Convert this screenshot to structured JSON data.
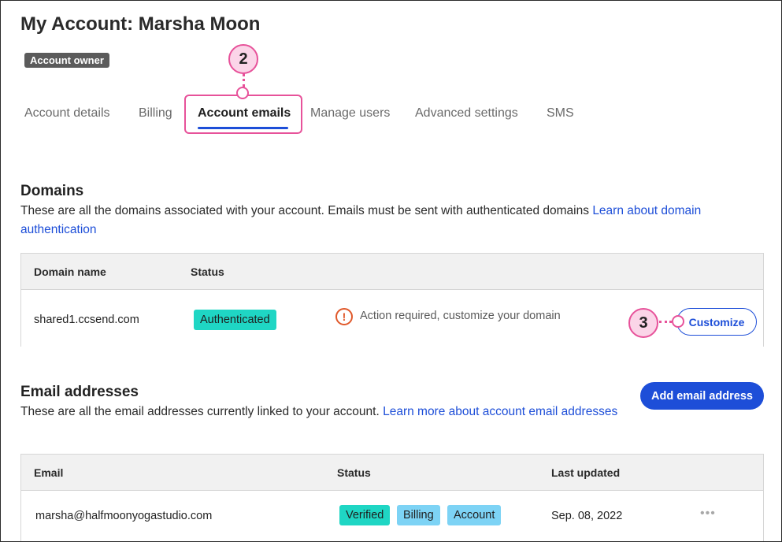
{
  "header": {
    "title": "My Account: Marsha Moon",
    "owner_badge": "Account owner"
  },
  "tabs": [
    {
      "label": "Account details",
      "active": false
    },
    {
      "label": "Billing",
      "active": false
    },
    {
      "label": "Account emails",
      "active": true
    },
    {
      "label": "Manage users",
      "active": false
    },
    {
      "label": "Advanced settings",
      "active": false
    },
    {
      "label": "SMS",
      "active": false
    }
  ],
  "callouts": {
    "tab_step": "2",
    "customize_step": "3",
    "color": "#e7529a"
  },
  "domains": {
    "title": "Domains",
    "description": "These are all the domains associated with your account. Emails must be sent with authenticated domains",
    "link_text": "Learn about domain authentication",
    "columns": {
      "domain": "Domain name",
      "status": "Status"
    },
    "rows": [
      {
        "domain": "shared1.ccsend.com",
        "status": "Authenticated",
        "warning_icon": "alert-circle-icon",
        "warning": "Action required, customize your domain",
        "action": "Customize"
      }
    ]
  },
  "emails": {
    "title": "Email addresses",
    "description": "These are all the email addresses currently linked to your account.",
    "link_text": "Learn more about account email addresses",
    "add_button": "Add email address",
    "columns": {
      "email": "Email",
      "status": "Status",
      "updated": "Last updated"
    },
    "rows": [
      {
        "email": "marsha@halfmoonyogastudio.com",
        "badges": [
          "Verified",
          "Billing",
          "Account"
        ],
        "updated": "Sep. 08, 2022",
        "more_icon": "more-horizontal-icon"
      }
    ]
  },
  "colors": {
    "accent": "#1d4ed8",
    "teal_badge": "#1fd6c4",
    "sky_badge": "#7dd3f5",
    "warning": "#e0582a"
  }
}
